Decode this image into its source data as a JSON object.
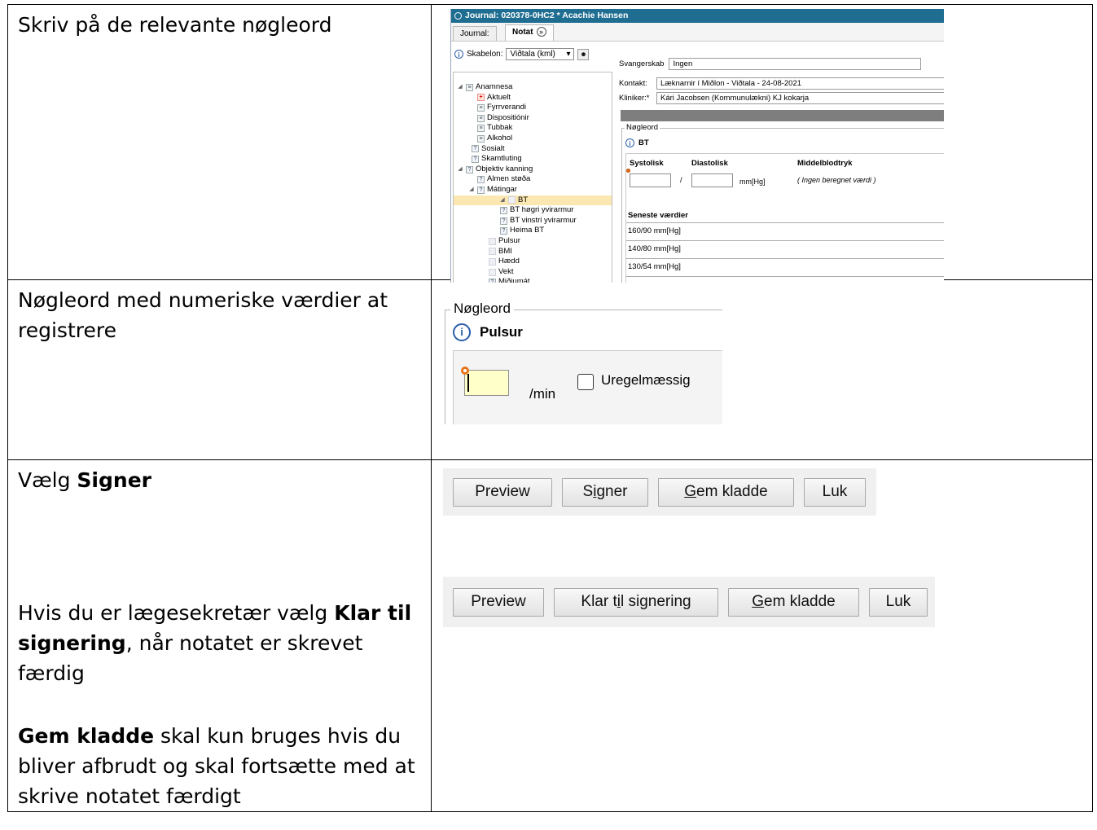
{
  "rows": [
    {
      "text": "Skriv på de relevante nøgleord"
    },
    {
      "text": "Nøgleord med numeriske værdier at registrere"
    },
    {
      "line1_prefix": "Vælg ",
      "line1_bold": "Signer",
      "line2_prefix": "Hvis du er lægesekretær vælg ",
      "line2_bold": "Klar til signering",
      "line2_suffix": ", når notatet er skrevet færdig",
      "line3_bold": "Gem kladde",
      "line3_suffix": " skal kun bruges hvis du bliver afbrudt og skal fortsætte med at skrive notatet færdigt"
    }
  ],
  "journal": {
    "title": "Journal: 020378-0HC2 * Acachie Hansen",
    "tabs": [
      "Journal:",
      "Notat"
    ],
    "skabelon_label": "Skabelon:",
    "skabelon_value": "Viðtala (kml)",
    "svangerskab_label": "Svangerskab",
    "svangerskab_value": "Ingen",
    "kontakt_label": "Kontakt:",
    "kontakt_value": "Læknarnir í Miðlon - Viðtala -  24-08-2021",
    "kliniker_label": "Kliniker:*",
    "kliniker_value": "Kári Jacobsen (Kommunulækni) KJ kokarja",
    "noegleord_legend": "Nøgleord",
    "bt_title": "BT",
    "systolisk": "Systolisk",
    "diastolisk": "Diastolisk",
    "middel": "Middelblodtryk",
    "slash": "/",
    "unit": "mm[Hg]",
    "ingen": "( Ingen beregnet værdi )",
    "seneste": "Seneste værdier",
    "values": [
      "160/90 mm[Hg]",
      "140/80 mm[Hg]",
      "130/54 mm[Hg]"
    ],
    "tree": [
      {
        "label": "Anamnesa",
        "level": 0,
        "toggle": "◢",
        "icon": "doc"
      },
      {
        "label": "Aktuelt",
        "level": 1,
        "icon": "plus"
      },
      {
        "label": "Fyrrverandi",
        "level": 1,
        "icon": "doc"
      },
      {
        "label": "Dispositiónir",
        "level": 1,
        "icon": "doc"
      },
      {
        "label": "Tubbak",
        "level": 1,
        "icon": "doc"
      },
      {
        "label": "Alkohol",
        "level": 1,
        "icon": "doc"
      },
      {
        "label": "Sosialt",
        "level": 0.5,
        "icon": "q"
      },
      {
        "label": "Skamtluting",
        "level": 0.5,
        "icon": "q"
      },
      {
        "label": "Objektiv kanning",
        "level": 0,
        "toggle": "◢",
        "icon": "q"
      },
      {
        "label": "Almen støða",
        "level": 1,
        "icon": "q"
      },
      {
        "label": "Mátingar",
        "level": 1,
        "toggle": "◢",
        "icon": "q"
      },
      {
        "label": "BT",
        "level": 2,
        "toggle": "◢",
        "icon": "blank",
        "selected": true
      },
      {
        "label": "BT høgri yvirarmur",
        "level": 3,
        "icon": "q"
      },
      {
        "label": "BT vinstri yvirarmur",
        "level": 3,
        "icon": "q"
      },
      {
        "label": "Heima BT",
        "level": 3,
        "icon": "q"
      },
      {
        "label": "Pulsur",
        "level": 2,
        "icon": "blank"
      },
      {
        "label": "BMI",
        "level": 2,
        "icon": "blank"
      },
      {
        "label": "Hædd",
        "level": 2,
        "icon": "blank"
      },
      {
        "label": "Vekt",
        "level": 2,
        "icon": "blank"
      },
      {
        "label": "Miðjumát",
        "level": 2,
        "icon": "q"
      }
    ]
  },
  "pulsur": {
    "legend": "Nøgleord",
    "title": "Pulsur",
    "unit": "/min",
    "checkbox_label": "Uregelmæssig"
  },
  "buttons_a": {
    "preview": "Preview",
    "signer_pre": "S",
    "signer_u": "i",
    "signer_post": "gner",
    "gem_u": "G",
    "gem_post": "em kladde",
    "luk": "Luk"
  },
  "buttons_b": {
    "preview": "Preview",
    "klar_pre": "Klar t",
    "klar_u": "i",
    "klar_post": "l signering",
    "gem_u": "G",
    "gem_post": "em kladde",
    "luk": "Luk"
  }
}
